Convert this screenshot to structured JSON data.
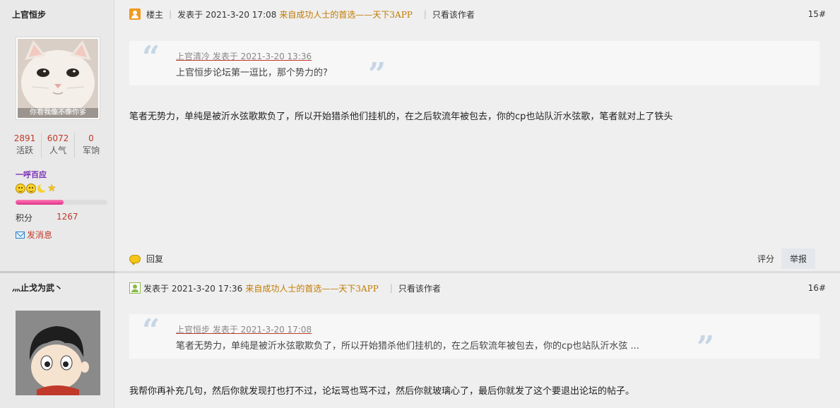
{
  "post1": {
    "author": "上官恒步",
    "avatar_caption": "你看我像不像你爹",
    "stats": [
      {
        "value": "2891",
        "label": "活跃"
      },
      {
        "value": "6072",
        "label": "人气"
      },
      {
        "value": "0",
        "label": "军饷"
      }
    ],
    "rank": "一呼百应",
    "level_progress": 0.52,
    "points_label": "积分",
    "points_value": "1267",
    "send_msg": "发消息",
    "owner_label": "楼主",
    "posted_at": "发表于  2021-3-20 17:08",
    "via": "来自成功人士的首选——天下3APP",
    "only_author": "只看该作者",
    "floor": "15#",
    "quote_head": "上官清冷 发表于 2021-3-20 13:36",
    "quote_text": "上官恒步论坛第一逗比，那个势力的?",
    "content": "笔者无势力，单纯是被沂水弦歌欺负了，所以开始猎杀他们挂机的，在之后软流年被包去，你的cp也站队沂水弦歌，笔者就对上了铁头",
    "reply": "回复",
    "rate": "评分",
    "report": "举报"
  },
  "post2": {
    "author": "灬止戈为武丶",
    "posted_at": "发表于  2021-3-20 17:36",
    "via": "来自成功人士的首选——天下3APP",
    "only_author": "只看该作者",
    "floor": "16#",
    "quote_head": "上官恒步 发表于 2021-3-20 17:08",
    "quote_text": "笔者无势力，单纯是被沂水弦歌欺负了，所以开始猎杀他们挂机的，在之后软流年被包去，你的cp也站队沂水弦 ...",
    "content": "我帮你再补充几句，然后你就发现打也打不过，论坛骂也骂不过，然后你就玻璃心了，最后你就发了这个要退出论坛的帖子。"
  }
}
